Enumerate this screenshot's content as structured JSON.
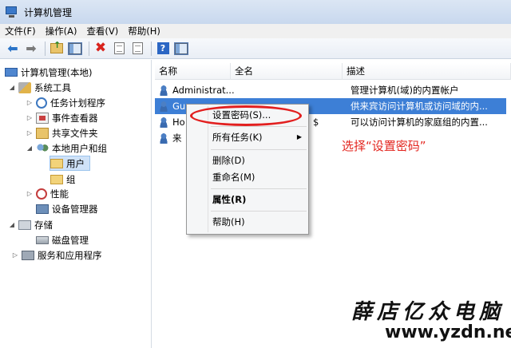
{
  "window": {
    "title": "计算机管理"
  },
  "menubar": [
    "文件(F)",
    "操作(A)",
    "查看(V)",
    "帮助(H)"
  ],
  "toolbar": {
    "buttons": [
      "back-arrow-icon",
      "forward-arrow-icon",
      "up-folder-icon",
      "show-hide-tree-icon",
      "delete-icon",
      "properties-icon",
      "export-list-icon",
      "help-icon",
      "show-hide-action-pane-icon"
    ]
  },
  "tree": {
    "root": "计算机管理(本地)",
    "system_tools": "系统工具",
    "task_scheduler": "任务计划程序",
    "event_viewer": "事件查看器",
    "shared_folders": "共享文件夹",
    "local_users_groups": "本地用户和组",
    "users": "用户",
    "groups": "组",
    "performance": "性能",
    "device_manager": "设备管理器",
    "storage": "存储",
    "disk_management": "磁盘管理",
    "services_apps": "服务和应用程序"
  },
  "list": {
    "columns": [
      "名称",
      "全名",
      "描述"
    ],
    "rows": [
      {
        "name": "Administrat...",
        "fullname": "",
        "description": "管理计算机(域)的内置帐户"
      },
      {
        "name": "Gu",
        "fullname": "",
        "description": "供来宾访问计算机或访问域的内..."
      },
      {
        "name": "Ho",
        "fullname": "$",
        "description": "可以访问计算机的家庭组的内置..."
      },
      {
        "name": "来",
        "fullname": "",
        "description": ""
      }
    ]
  },
  "context_menu": {
    "set_password": "设置密码(S)...",
    "all_tasks": "所有任务(K)",
    "delete": "删除(D)",
    "rename": "重命名(M)",
    "properties": "属性(R)",
    "help": "帮助(H)"
  },
  "annotation": "选择“设置密码”",
  "watermark": {
    "cn": "薛店亿众电脑",
    "url": "www.yzdn.net"
  },
  "colors": {
    "selection": "#3d7fd6",
    "annotation": "#e3261f",
    "ellipse": "#e21f1f"
  }
}
